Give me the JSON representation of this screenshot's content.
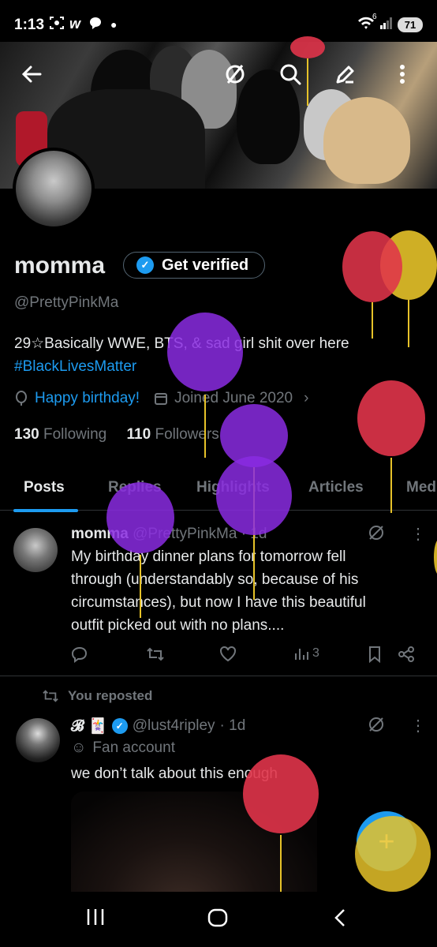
{
  "status_bar": {
    "time": "1:13",
    "icons": [
      "screenshot-icon",
      "w-app-icon",
      "chat-icon",
      "dot-icon"
    ],
    "wifi_label": "6",
    "battery": "71"
  },
  "header": {
    "back_icon": "arrow-left-icon",
    "actions": [
      "grok-icon",
      "search-icon",
      "edit-icon",
      "more-vertical-icon"
    ]
  },
  "profile": {
    "display_name": "momma",
    "get_verified_label": "Get verified",
    "handle": "@PrettyPinkMa",
    "bio_line1": "29☆Basically WWE, BTS, & sad girl shit over here",
    "bio_hashtag": "#BlackLivesMatter",
    "birthday_label": "Happy birthday!",
    "joined_label": "Joined June 2020",
    "following_count": "130",
    "following_label": "Following",
    "followers_count": "110",
    "followers_label": "Followers"
  },
  "tabs": [
    "Posts",
    "Replies",
    "Highlights",
    "Articles",
    "Media"
  ],
  "active_tab": "Posts",
  "posts": [
    {
      "author": "momma",
      "handle": "@PrettyPinkMa",
      "time": "· 1d",
      "lines": [
        "My birthday dinner plans for tomorrow fell",
        "through (understandably so, because of his",
        "circumstances), but now I have this beautiful",
        "outfit picked out with no plans...."
      ],
      "views": "3"
    },
    {
      "reposted_label": "You reposted",
      "author": "𝓑 🃏",
      "handle": "@lust4ripley",
      "time": "· 1d",
      "sub_label": "Fan account",
      "text": "we don’t talk about this enough"
    }
  ],
  "fab_label": "+",
  "colors": {
    "accent": "#1d9bf0",
    "background": "#000000",
    "muted": "#71767b",
    "text": "#e7e9ea",
    "balloon_purple": "#8a2be2",
    "balloon_red": "#e0344a",
    "balloon_yellow": "#e6c229"
  }
}
